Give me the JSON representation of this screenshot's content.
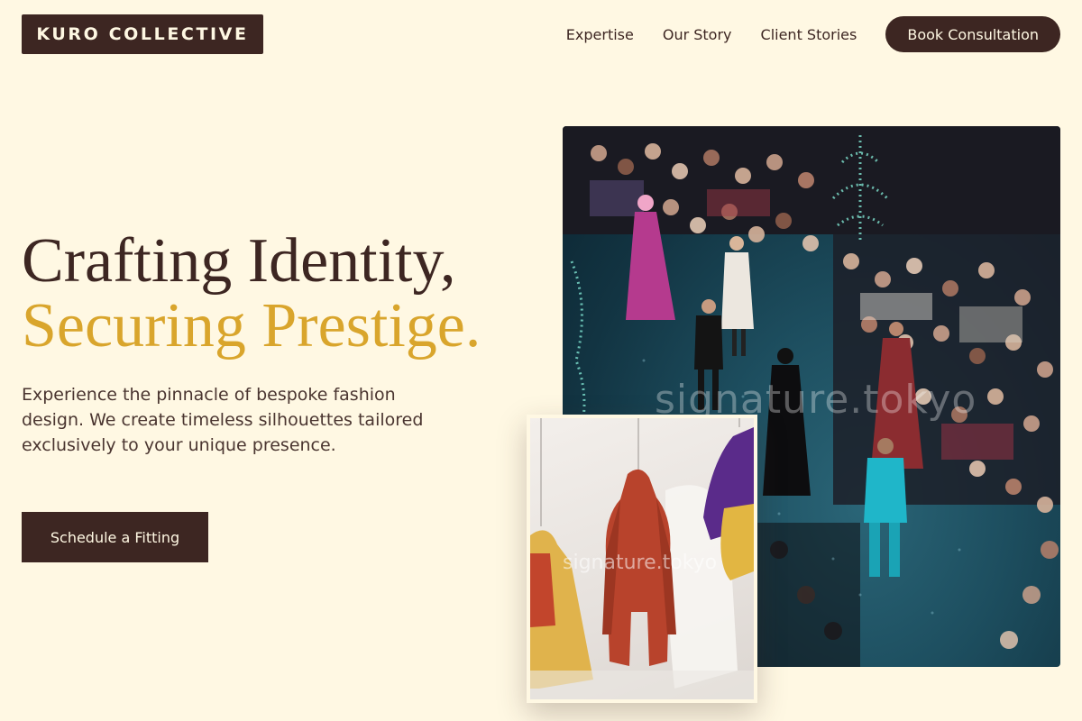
{
  "brand": {
    "name": "KURO COLLECTIVE"
  },
  "nav": {
    "links": [
      "Expertise",
      "Our Story",
      "Client Stories"
    ],
    "cta": "Book Consultation"
  },
  "hero": {
    "title_line1": "Crafting Identity,",
    "title_line2": "Securing Prestige.",
    "description": "Experience the pinnacle of bespoke fashion design. We create timeless silhouettes tailored exclusively to your unique presence.",
    "cta": "Schedule a Fitting"
  },
  "images": {
    "main_watermark": "signature.tokyo",
    "inset_watermark": "signature.tokyo"
  },
  "colors": {
    "background": "#fff8e3",
    "primary": "#3d2622",
    "accent": "#d9a52c"
  }
}
